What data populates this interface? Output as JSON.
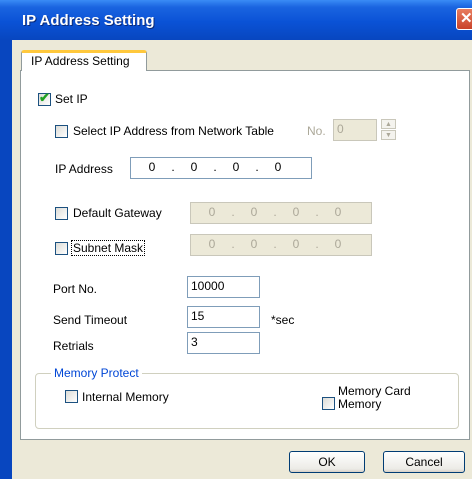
{
  "window": {
    "title": "IP Address Setting"
  },
  "tab": {
    "label": "IP Address Setting"
  },
  "set_ip": {
    "label": "Set IP",
    "checked": true
  },
  "select_from_table": {
    "label": "Select IP Address from Network Table",
    "checked": false,
    "no_label": "No.",
    "no_value": "0"
  },
  "ip_address": {
    "label": "IP Address",
    "octets": [
      "0",
      "0",
      "0",
      "0"
    ]
  },
  "default_gateway": {
    "label": "Default Gateway",
    "checked": false,
    "octets": [
      "0",
      "0",
      "0",
      "0"
    ]
  },
  "subnet_mask": {
    "label": "Subnet Mask",
    "checked": false,
    "octets": [
      "0",
      "0",
      "0",
      "0"
    ]
  },
  "port": {
    "label": "Port No.",
    "value": "10000"
  },
  "send_timeout": {
    "label": "Send Timeout",
    "value": "15",
    "unit": "*sec"
  },
  "retrials": {
    "label": "Retrials",
    "value": "3"
  },
  "memory_protect": {
    "legend": "Memory Protect",
    "internal": {
      "label": "Internal Memory",
      "checked": false
    },
    "card": {
      "label_line1": "Memory Card",
      "label_line2": "Memory",
      "checked": false
    }
  },
  "buttons": {
    "ok": "OK",
    "cancel": "Cancel"
  },
  "colors": {
    "title_bar": "#0a52d6",
    "client_bg": "#ece9d8",
    "legend_text": "#0046d5",
    "check_mark": "#21a121"
  }
}
